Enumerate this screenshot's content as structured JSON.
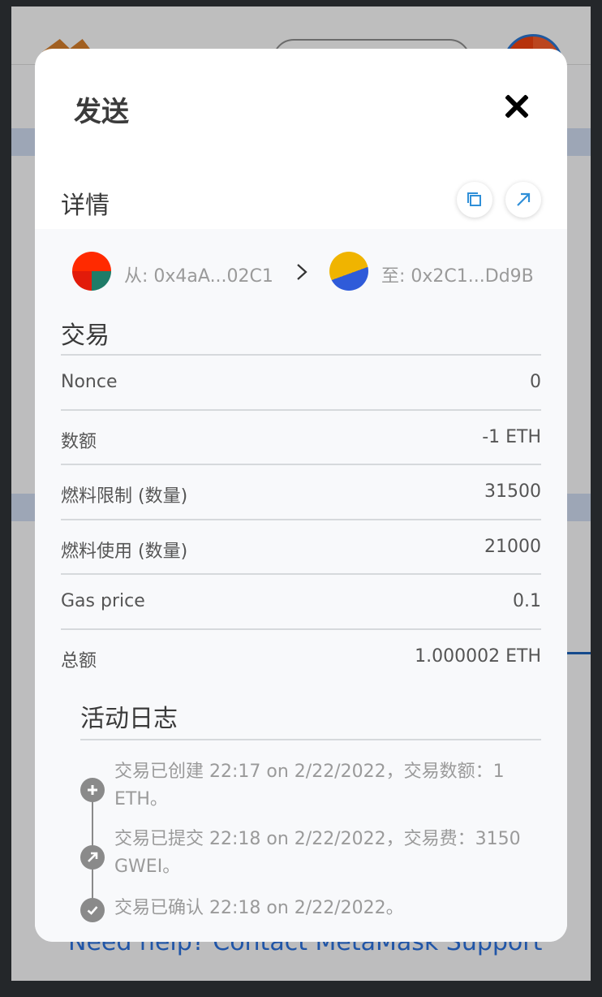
{
  "modal": {
    "title": "发送",
    "details_label": "详情",
    "from": {
      "label": "从: 0x4aA...02C1"
    },
    "to": {
      "label": "至: 0x2C1...Dd9B"
    }
  },
  "transaction": {
    "title": "交易",
    "rows": [
      {
        "label": "Nonce",
        "value": "0"
      },
      {
        "label": "数额",
        "value": "-1 ETH"
      },
      {
        "label": "燃料限制 (数量)",
        "value": "31500"
      },
      {
        "label": "燃料使用 (数量)",
        "value": "21000"
      },
      {
        "label": "Gas price",
        "value": "0.1"
      },
      {
        "label": "总额",
        "value": "1.000002 ETH"
      }
    ]
  },
  "activity_log": {
    "title": "活动日志",
    "entries": [
      {
        "icon": "plus-icon",
        "text": "交易已创建 22:17 on 2/22/2022，交易数额：1 ETH。"
      },
      {
        "icon": "arrow-up-right-icon",
        "text": "交易已提交 22:18 on 2/22/2022，交易费：3150 GWEI。"
      },
      {
        "icon": "checkmark-icon",
        "text": "交易已确认 22:18 on 2/22/2022。"
      }
    ]
  },
  "background": {
    "help_text": "Need help? Contact MetaMask Support"
  },
  "colors": {
    "accent_blue": "#2f8fd8",
    "text_primary": "#3a3a3a",
    "text_muted": "#9a9a9a"
  }
}
